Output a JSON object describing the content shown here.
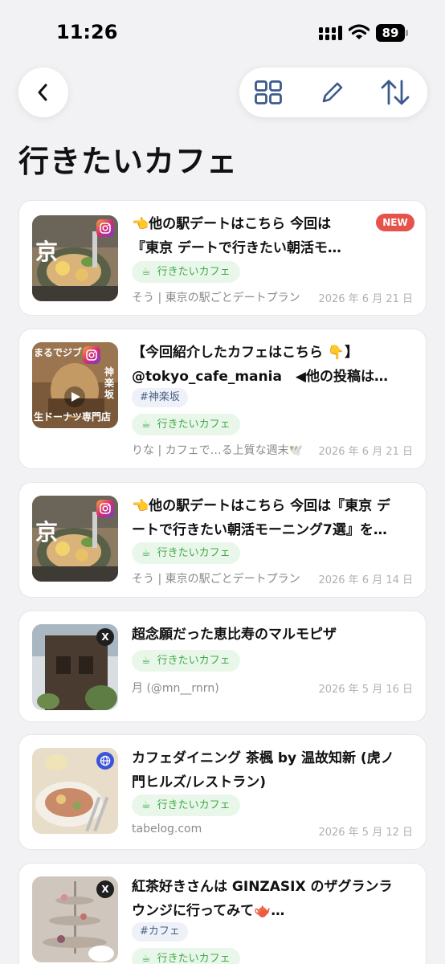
{
  "status": {
    "time": "11:26",
    "battery": "89"
  },
  "header": {
    "title": "行きたいカフェ"
  },
  "toolbar": {
    "icons": [
      "grid-icon",
      "pencil-icon",
      "sort-icon"
    ]
  },
  "colors": {
    "new_badge": "#e5534b",
    "chip_green": "#44a84c",
    "accent_blue": "#3d5a8c"
  },
  "items": [
    {
      "title_lines": [
        "👈他の駅デートはこちら 今回は",
        "『東京 デートで行きたい朝活モ…"
      ],
      "new_label": "NEW",
      "category": "行きたいカフェ",
      "source": "そう | 東京の駅ごとデートプラン",
      "date": "2026 年 6 月 21 日",
      "thumb_text": "京",
      "badge": "instagram-icon"
    },
    {
      "title_lines": [
        "【今回紹介したカフェはこちら 👇】",
        "@tokyo_cafe_mania　◀他の投稿は…"
      ],
      "tag": "#神楽坂",
      "category": "行きたいカフェ",
      "source": "りな | カフェで…る上質な週末🕊️",
      "date": "2026 年 6 月 21 日",
      "thumb_texts": [
        "まるでジブリ",
        "神楽坂",
        "生ドーナツ専門店"
      ],
      "badge": "instagram-icon"
    },
    {
      "title_lines": [
        "👈他の駅デートはこちら 今回は『東京 デ",
        "ートで行きたい朝活モーニング7選』を…"
      ],
      "category": "行きたいカフェ",
      "source": "そう | 東京の駅ごとデートプラン",
      "date": "2026 年 6 月 14 日",
      "thumb_text": "京",
      "badge": "instagram-icon"
    },
    {
      "title_lines": [
        "超念願だった恵比寿のマルモピザ"
      ],
      "category": "行きたいカフェ",
      "source": "月 (@mn__rnrn)",
      "date": "2026 年 5 月 16 日",
      "badge": "x-icon",
      "badge_text": "X"
    },
    {
      "title_lines": [
        "カフェダイニング 茶楓 by 温故知新 (虎ノ",
        "門ヒルズ/レストラン)"
      ],
      "category": "行きたいカフェ",
      "source": "tabelog.com",
      "date": "2026 年 5 月 12 日",
      "badge": "globe-icon"
    },
    {
      "title_lines": [
        "紅茶好きさんは GINZASIX のザグランラ",
        "ウンジに行ってみて🫖…"
      ],
      "tag": "#カフェ",
      "category": "行きたいカフェ",
      "badge": "x-icon",
      "badge_text": "X"
    }
  ]
}
